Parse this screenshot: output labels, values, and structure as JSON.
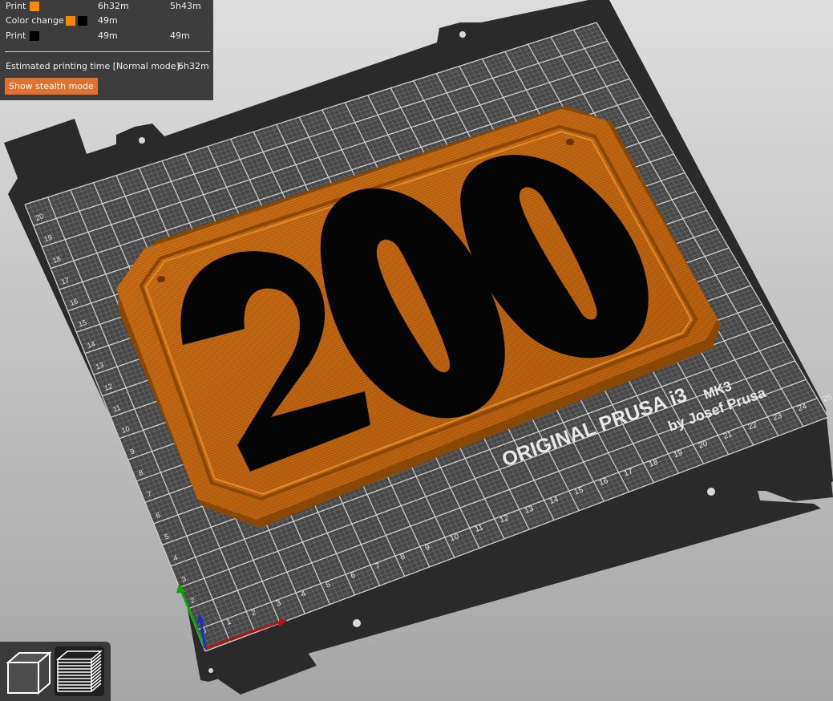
{
  "legend": {
    "rows": [
      {
        "label": "Print",
        "swatches": [
          "#ff8800"
        ],
        "time_normal": "6h32m",
        "time_stealth": "5h43m"
      },
      {
        "label": "Color change",
        "swatches": [
          "#ff8800",
          "#000000"
        ],
        "time_normal": "49m",
        "time_stealth": ""
      },
      {
        "label": "Print",
        "swatches": [
          "#000000"
        ],
        "time_normal": "49m",
        "time_stealth": "49m"
      }
    ],
    "estimate_label": "Estimated printing time [Normal mode]:",
    "estimate_value": "6h32m",
    "stealth_button": "Show stealth mode"
  },
  "bed": {
    "brand_line1": "ORIGINAL PRUSA i3",
    "brand_model": "MK3",
    "brand_line2": "by Josef Prusa",
    "x_ticks": [
      "0",
      "1",
      "2",
      "3",
      "4",
      "5",
      "6",
      "7",
      "8",
      "9",
      "10",
      "11",
      "12",
      "13",
      "14",
      "15",
      "16",
      "17",
      "18",
      "19",
      "20",
      "21",
      "22",
      "23",
      "24",
      "25"
    ],
    "y_ticks": [
      "2",
      "3",
      "4",
      "5",
      "6",
      "7",
      "8",
      "9",
      "10",
      "11",
      "12",
      "13",
      "14",
      "15",
      "16",
      "17",
      "18",
      "19",
      "20"
    ]
  },
  "model": {
    "text": "200",
    "base_color": "#c86a10",
    "text_color": "#050505"
  },
  "toolbar": {
    "buttons": [
      {
        "name": "3d-view",
        "icon": "cube-icon"
      },
      {
        "name": "preview",
        "icon": "layers-icon"
      }
    ]
  },
  "colors": {
    "background_top": "#dcdcdc",
    "background_bottom": "#a7a7a7",
    "bed_dark": "#2b2b2b",
    "bed_surface": "#4a4a4a",
    "grid_line": "#bfbfbf",
    "accent": "#e0712f"
  }
}
